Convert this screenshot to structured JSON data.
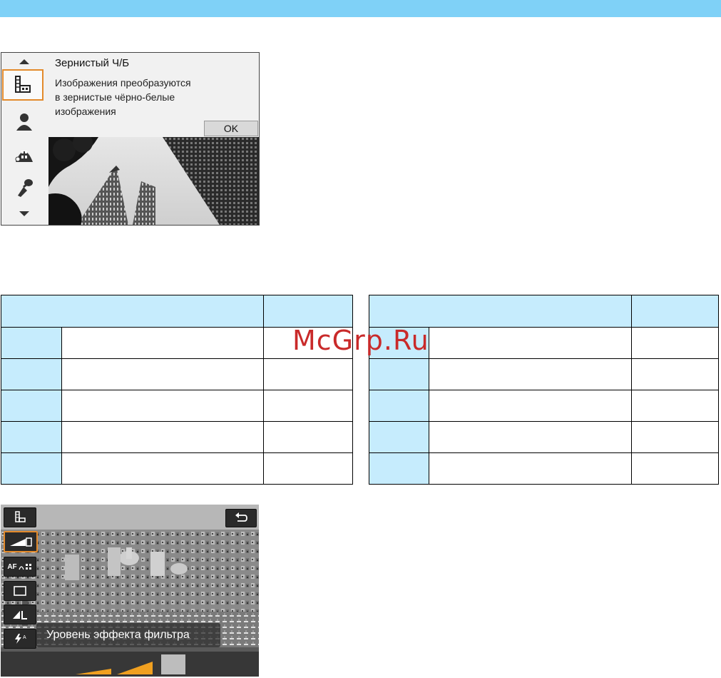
{
  "screen1": {
    "title": "Зернистый Ч/Б",
    "description_lines": [
      "Изображения преобразуются",
      "в зернистые чёрно-белые",
      "изображения"
    ],
    "ok_label": "OK",
    "modes": [
      "grainy-bw-icon",
      "soft-focus-icon",
      "fisheye-icon",
      "art-bold-icon"
    ]
  },
  "watermark": "McGrp.Ru",
  "screen2": {
    "menu_icons": [
      "filter-icon",
      "effect-level-icon",
      "af-method-icon",
      "drive-mode-icon",
      "image-quality-icon",
      "flash-icon"
    ],
    "af_label": "AF",
    "effect_label": "Уровень эффекта фильтра",
    "levels": {
      "count": 3,
      "selected": 2
    },
    "colors": {
      "accent": "#e38a2b",
      "level_active": "#f0a020",
      "level_inactive": "#bdbdbd"
    }
  },
  "colors": {
    "header_band": "#7fd1f7",
    "table_key": "#c6ecfd"
  }
}
